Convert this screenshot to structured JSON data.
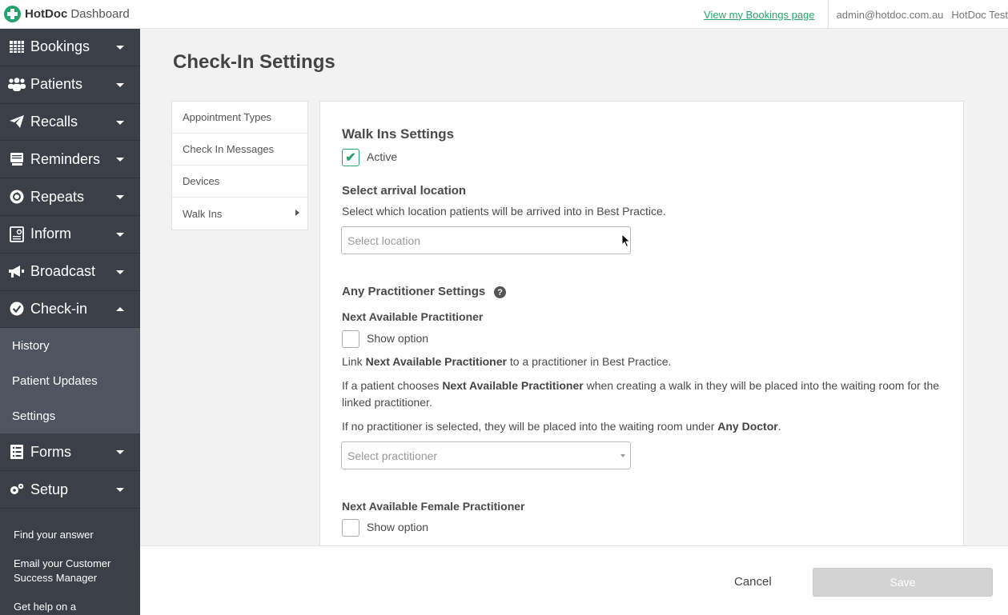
{
  "header": {
    "brand": "HotDoc",
    "brand_sub": "Dashboard",
    "bookings_link": "View my Bookings page",
    "user": "admin@hotdoc.com.au",
    "org": "HotDoc Test"
  },
  "sidebar": {
    "items": [
      {
        "label": "Bookings",
        "icon": "calendar-grid-icon"
      },
      {
        "label": "Patients",
        "icon": "users-icon"
      },
      {
        "label": "Recalls",
        "icon": "paper-plane-icon"
      },
      {
        "label": "Reminders",
        "icon": "message-icon"
      },
      {
        "label": "Repeats",
        "icon": "repeat-icon"
      },
      {
        "label": "Inform",
        "icon": "document-icon"
      },
      {
        "label": "Broadcast",
        "icon": "megaphone-icon"
      },
      {
        "label": "Check-in",
        "icon": "check-circle-icon"
      }
    ],
    "checkin_sub": [
      "History",
      "Patient Updates",
      "Settings"
    ],
    "items_after": [
      {
        "label": "Forms",
        "icon": "list-icon"
      },
      {
        "label": "Setup",
        "icon": "gears-icon"
      }
    ],
    "links": [
      "Find your answer",
      "Email your Customer Success Manager",
      "Get help on a technical"
    ]
  },
  "page": {
    "title": "Check-In Settings"
  },
  "subnav": [
    "Appointment Types",
    "Check In Messages",
    "Devices",
    "Walk Ins"
  ],
  "walkins": {
    "title": "Walk Ins Settings",
    "active_label": "Active",
    "location_title": "Select arrival location",
    "location_desc": "Select which location patients will be arrived into in Best Practice.",
    "location_placeholder": "Select location"
  },
  "any_practitioner": {
    "title": "Any Practitioner Settings",
    "next_title": "Next Available Practitioner",
    "show_option": "Show option",
    "link_pre": "Link ",
    "link_bold": "Next Available Practitioner",
    "link_post": " to a practitioner in Best Practice.",
    "if_pre": "If a patient chooses ",
    "if_bold": "Next Available Practitioner",
    "if_post": " when creating a walk in they will be placed into the waiting room for the linked practitioner.",
    "none_pre": "If no practitioner is selected, they will be placed into the waiting room under ",
    "none_bold": "Any Doctor",
    "none_post": ".",
    "practitioner_placeholder": "Select practitioner",
    "female_title": "Next Available Female Practitioner",
    "female_show_option": "Show option"
  },
  "footer": {
    "cancel": "Cancel",
    "save": "Save"
  }
}
